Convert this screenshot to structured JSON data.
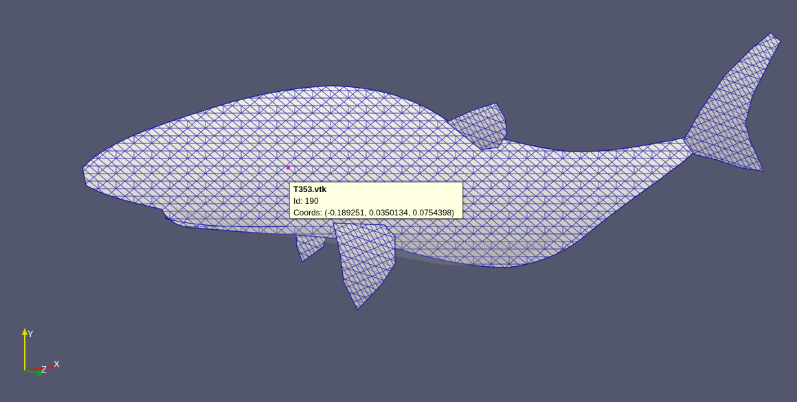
{
  "render_view": {
    "background_color": "#52576e",
    "surface_color": "#e8e4df",
    "mesh_edge_color": "#1c1ea0",
    "picked_point_color": "#d020d0"
  },
  "tooltip": {
    "title": "T353.vtk",
    "id_line": "Id: 190",
    "coords_line": "Coords: (-0.189251, 0.0350134, 0.0754398)"
  },
  "orientation_axes": {
    "y_label": "Y",
    "x_label": "X",
    "z_label": "Z",
    "y_color": "#e6d800",
    "x_color": "#d01818",
    "z_color": "#10a020"
  }
}
